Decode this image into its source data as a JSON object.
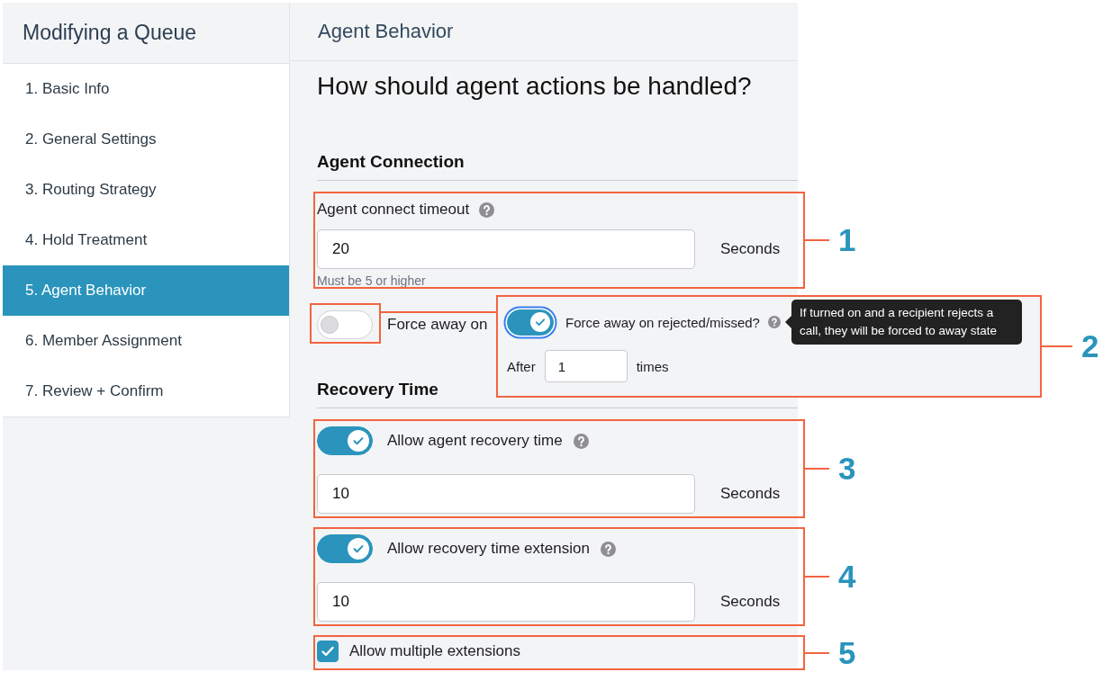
{
  "sidebar": {
    "title": "Modifying a Queue",
    "items": [
      {
        "label": "1. Basic Info",
        "selected": false
      },
      {
        "label": "2. General Settings",
        "selected": false
      },
      {
        "label": "3. Routing Strategy",
        "selected": false
      },
      {
        "label": "4. Hold Treatment",
        "selected": false
      },
      {
        "label": "5. Agent Behavior",
        "selected": true
      },
      {
        "label": "6. Member Assignment",
        "selected": false
      },
      {
        "label": "7. Review + Confirm",
        "selected": false
      }
    ]
  },
  "panel": {
    "title": "Agent Behavior",
    "heading": "How should agent actions be handled?",
    "sections": [
      {
        "title": "Agent Connection",
        "fields": [
          {
            "kind": "number",
            "label": "Agent connect timeout",
            "help": true,
            "value": "20",
            "unit": "Seconds",
            "hint": "Must be 5 or higher",
            "callout": "1"
          },
          {
            "kind": "toggle",
            "on": false,
            "label": "Force away on",
            "zoom": {
              "callout": "2",
              "toggle": {
                "on": true,
                "focused": true
              },
              "label": "Force away on rejected/missed?",
              "help": true,
              "tooltip": "If turned on and a recipient rejects a call, they will be forced to away state",
              "prefix": "After",
              "value": "1",
              "unit": "times"
            }
          }
        ]
      },
      {
        "title": "Recovery Time",
        "fields": [
          {
            "kind": "toggle_number",
            "on": true,
            "label": "Allow agent recovery time",
            "help": true,
            "value": "10",
            "unit": "Seconds",
            "callout": "3"
          },
          {
            "kind": "toggle_number",
            "on": true,
            "label": "Allow recovery time extension",
            "help": true,
            "value": "10",
            "unit": "Seconds",
            "callout": "4"
          },
          {
            "kind": "checkbox",
            "checked": true,
            "label": "Allow multiple extensions",
            "callout": "5"
          }
        ]
      }
    ]
  }
}
